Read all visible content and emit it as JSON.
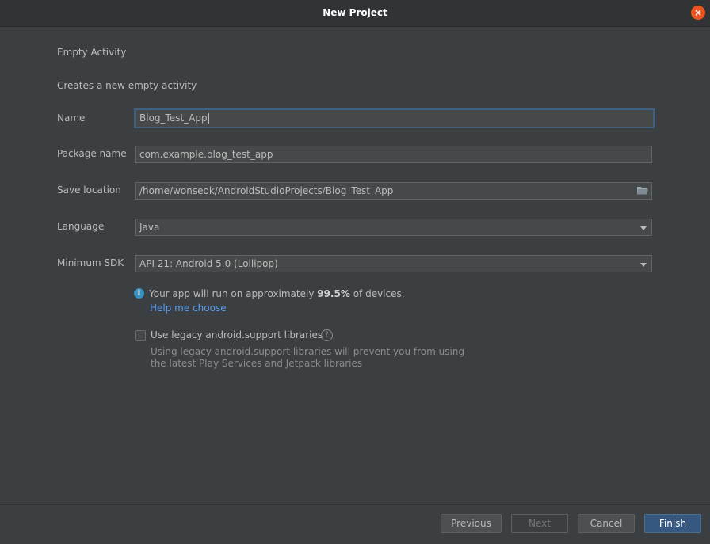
{
  "window": {
    "title": "New Project",
    "close_icon": "×"
  },
  "header": {
    "section_title": "Empty Activity",
    "description": "Creates a new empty activity"
  },
  "form": {
    "name": {
      "label": "Name",
      "value": "Blog_Test_App"
    },
    "package": {
      "label": "Package name",
      "value": "com.example.blog_test_app"
    },
    "save_location": {
      "label": "Save location",
      "value": "/home/wonseok/AndroidStudioProjects/Blog_Test_App"
    },
    "language": {
      "label": "Language",
      "value": "Java"
    },
    "min_sdk": {
      "label": "Minimum SDK",
      "value": "API 21: Android 5.0 (Lollipop)"
    }
  },
  "info": {
    "icon": "i",
    "text_prefix": "Your app will run on approximately ",
    "percentage": "99.5%",
    "text_suffix": " of devices.",
    "link": "Help me choose"
  },
  "legacy": {
    "checked": false,
    "label": "Use legacy android.support libraries",
    "help_icon": "?",
    "hint_line1": "Using legacy android.support libraries will prevent you from using",
    "hint_line2": "the latest Play Services and Jetpack libraries"
  },
  "buttons": {
    "previous": "Previous",
    "next": "Next",
    "cancel": "Cancel",
    "finish": "Finish"
  },
  "colors": {
    "accent": "#365880",
    "link": "#589df6",
    "close": "#e95420",
    "info": "#3592c4"
  }
}
